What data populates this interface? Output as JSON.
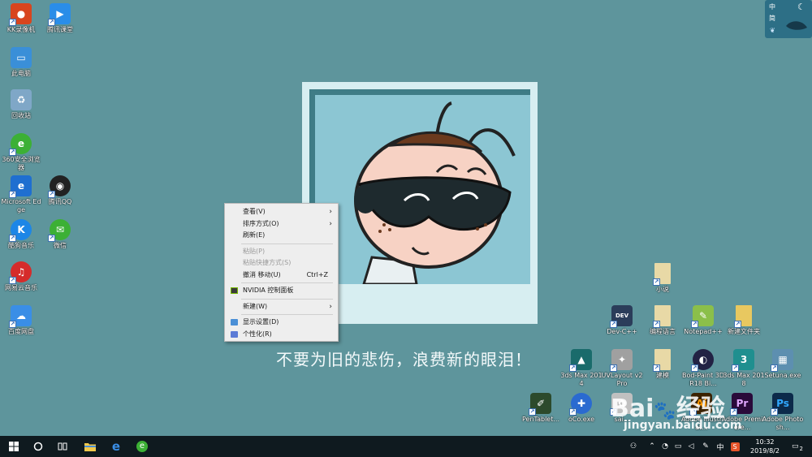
{
  "desktop_icons": [
    {
      "label": "KK录像机",
      "color": "#d8451e"
    },
    {
      "label": "腾讯课堂",
      "color": "#2a8de8"
    },
    {
      "label": "此电脑",
      "color": "#3a8fd8"
    },
    {
      "label": "回收站",
      "color": "#7fa7c7"
    },
    {
      "label": "360安全浏览器",
      "color": "#3cb035"
    },
    {
      "label": "Microsoft Edge",
      "color": "#1f6fd0"
    },
    {
      "label": "腾讯QQ",
      "color": "#222222"
    },
    {
      "label": "酷狗音乐",
      "color": "#1d86e6"
    },
    {
      "label": "微信",
      "color": "#3cb035"
    },
    {
      "label": "网易云音乐",
      "color": "#d52b2b"
    },
    {
      "label": "百度网盘",
      "color": "#3a8ee6"
    },
    {
      "label": "小说",
      "color": "#e8d9a6"
    },
    {
      "label": "Dev-C++",
      "color": "#2b3d5a"
    },
    {
      "label": "编程语言",
      "color": "#e8d9a6"
    },
    {
      "label": "Notepad++",
      "color": "#8bbf4a"
    },
    {
      "label": "新建文件夹",
      "color": "#e8c860"
    },
    {
      "label": "3ds Max 2014",
      "color": "#1a6b6b"
    },
    {
      "label": "UVLayout v2 Pro",
      "color": "#a0a0a0"
    },
    {
      "label": "建模",
      "color": "#e8d9a6"
    },
    {
      "label": "Bod-Paint 3D R18 Bi...",
      "color": "#222244"
    },
    {
      "label": "3ds Max 2018",
      "color": "#1f8f8f"
    },
    {
      "label": "Setuna.exe",
      "color": "#5d8fb0"
    },
    {
      "label": "PenTablet...",
      "color": "#2c4a2c"
    },
    {
      "label": "oCo.exe",
      "color": "#2a6ad0"
    },
    {
      "label": "sai...",
      "color": "#c0c0c0"
    },
    {
      "label": "Adobe Illustrat...",
      "color": "#3b2200"
    },
    {
      "label": "Adobe Premiere...",
      "color": "#2a0a3a"
    },
    {
      "label": "Adobe Photosh...",
      "color": "#0c2a4a"
    }
  ],
  "wallpaper": {
    "caption": "不要为旧的悲伤，浪费新的眼泪！"
  },
  "context_menu": {
    "items": [
      {
        "label": "查看(V)",
        "submenu": true,
        "disabled": false
      },
      {
        "label": "排序方式(O)",
        "submenu": true,
        "disabled": false
      },
      {
        "label": "刷新(E)",
        "submenu": false,
        "disabled": false
      },
      {
        "label": "粘贴(P)",
        "submenu": false,
        "disabled": true
      },
      {
        "label": "粘贴快捷方式(S)",
        "submenu": false,
        "disabled": true
      },
      {
        "label": "撤消 移动(U)",
        "shortcut": "Ctrl+Z",
        "submenu": false,
        "disabled": false
      },
      {
        "label": "NVIDIA 控制面板",
        "submenu": false,
        "disabled": false
      },
      {
        "label": "新建(W)",
        "submenu": true,
        "disabled": false
      },
      {
        "label": "显示设置(D)",
        "submenu": false,
        "disabled": false
      },
      {
        "label": "个性化(R)",
        "submenu": false,
        "disabled": false
      }
    ]
  },
  "widget": {
    "line1": "中",
    "line2": "简"
  },
  "watermark": {
    "logo": "Bai",
    "logo2": "经验",
    "url": "jingyan.baidu.com"
  },
  "taskbar": {
    "ime": "中",
    "time": "10:32",
    "date": "2019/8/2",
    "notification_count": "2"
  },
  "colors": {
    "desktop": "#5e959c",
    "taskbar": "#0f1a1f",
    "menu_bg": "#eeeeee"
  }
}
